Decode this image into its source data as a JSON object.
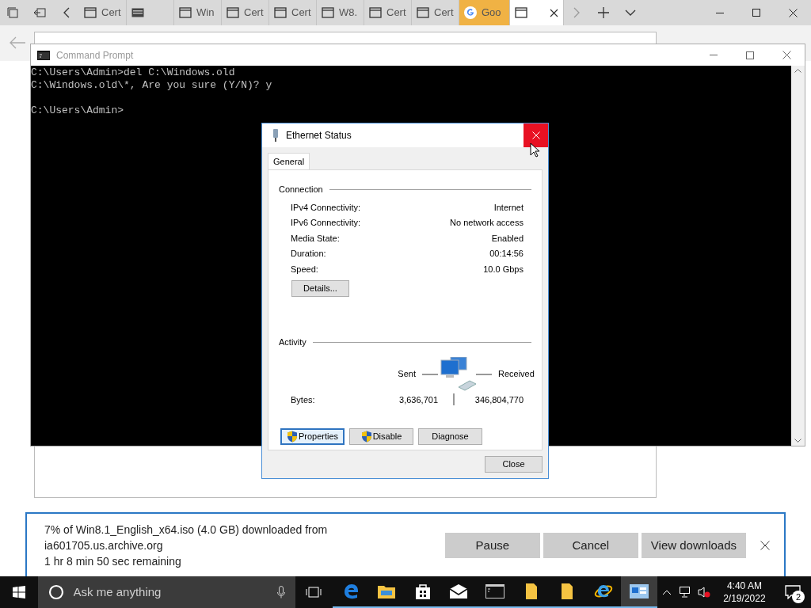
{
  "browser_tabs": [
    {
      "label": "Cert",
      "kind": "page",
      "selected": false,
      "highlighted": false
    },
    {
      "kind": "keyboard",
      "selected": false,
      "highlighted": false
    },
    {
      "label": "Win",
      "kind": "page",
      "selected": false,
      "highlighted": false
    },
    {
      "label": "Cert",
      "kind": "page",
      "selected": false,
      "highlighted": false
    },
    {
      "label": "Cert",
      "kind": "page",
      "selected": false,
      "highlighted": false
    },
    {
      "label": "W8.",
      "kind": "page",
      "selected": false,
      "highlighted": false
    },
    {
      "label": "Cert",
      "kind": "page",
      "selected": false,
      "highlighted": false
    },
    {
      "label": "Cert",
      "kind": "page",
      "selected": false,
      "highlighted": false
    },
    {
      "label": "Goo",
      "kind": "google",
      "selected": false,
      "highlighted": true
    },
    {
      "kind": "page",
      "selected": true,
      "highlighted": false
    }
  ],
  "console": {
    "title": "Command Prompt",
    "lines": [
      {
        "kind": "text",
        "text": "C:\\Users\\Admin>del C:\\Windows.old"
      },
      {
        "kind": "text",
        "text": "C:\\Windows.old\\*, Are you sure (Y/N)? y"
      },
      {
        "kind": "blank"
      },
      {
        "kind": "text",
        "text": "C:\\Users\\Admin>"
      }
    ]
  },
  "dialog": {
    "title": "Ethernet Status",
    "tabs": [
      {
        "label": "General",
        "selected": true
      }
    ],
    "connection": {
      "heading": "Connection",
      "rows": [
        {
          "label": "IPv4 Connectivity:",
          "value": "Internet"
        },
        {
          "label": "IPv6 Connectivity:",
          "value": "No network access"
        },
        {
          "label": "Media State:",
          "value": "Enabled"
        },
        {
          "label": "Duration:",
          "value": "00:14:56"
        },
        {
          "label": "Speed:",
          "value": "10.0 Gbps"
        }
      ],
      "details_button": "Details..."
    },
    "activity": {
      "heading": "Activity",
      "sent_label": "Sent",
      "received_label": "Received",
      "bytes_label": "Bytes:",
      "sent": "3,636,701",
      "received": "346,804,770"
    },
    "buttons": [
      {
        "label": "Properties",
        "shield": true,
        "focused": true
      },
      {
        "label": "Disable",
        "shield": true,
        "focused": false
      },
      {
        "label": "Diagnose",
        "shield": false,
        "focused": false
      }
    ],
    "close_button": "Close"
  },
  "download_bar": {
    "lines": [
      "7% of Win8.1_English_x64.iso (4.0 GB) downloaded from",
      "ia601705.us.archive.org",
      "1 hr 8 min 50 sec remaining"
    ],
    "buttons": [
      "Pause",
      "Cancel",
      "View downloads"
    ]
  },
  "taskbar": {
    "search_placeholder": "Ask me anything",
    "apps": [
      {
        "kind": "edge",
        "selected": false
      },
      {
        "kind": "explorer",
        "selected": false
      },
      {
        "kind": "store",
        "selected": false
      },
      {
        "kind": "mail",
        "selected": false
      },
      {
        "kind": "cmd",
        "selected": false
      },
      {
        "kind": "folder",
        "selected": false
      },
      {
        "kind": "folder",
        "selected": false
      },
      {
        "kind": "ie",
        "selected": false
      },
      {
        "kind": "network",
        "selected": true
      }
    ],
    "time": "4:40 AM",
    "date": "2/19/2022",
    "notifications": "2"
  }
}
